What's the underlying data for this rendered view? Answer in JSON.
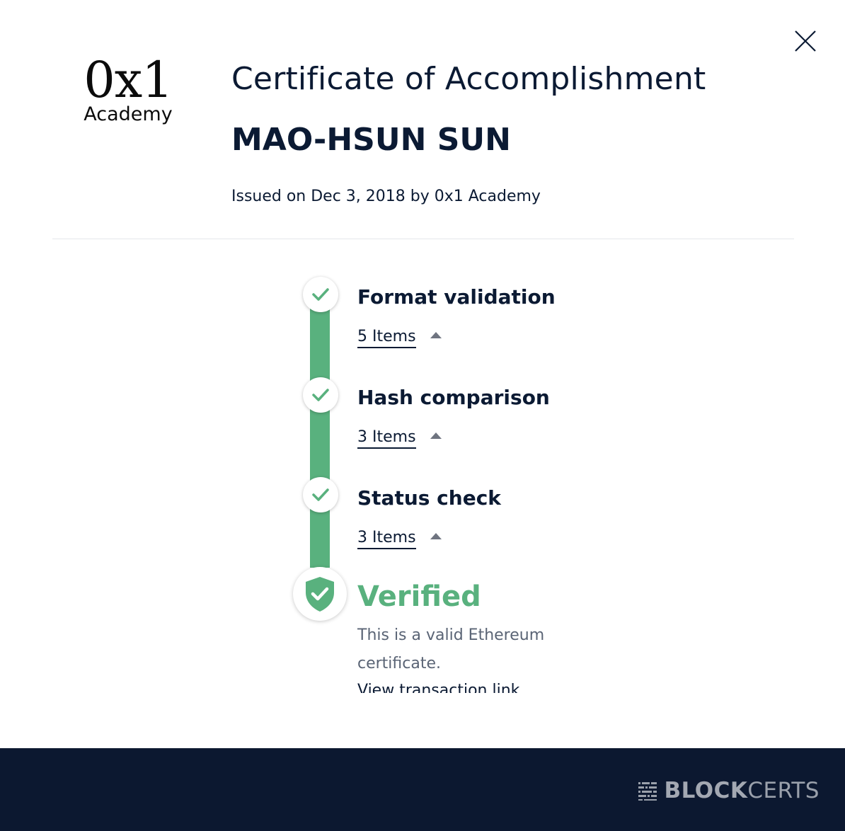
{
  "header": {
    "logo": {
      "mark": "0x1",
      "sub": "Academy"
    },
    "title": "Certificate of Accomplishment",
    "recipient": "MAO-HSUN SUN",
    "issued": "Issued on Dec 3, 2018 by 0x1 Academy"
  },
  "steps": [
    {
      "title": "Format validation",
      "items": "5 Items",
      "status": "passed"
    },
    {
      "title": "Hash comparison",
      "items": "3 Items",
      "status": "passed"
    },
    {
      "title": "Status check",
      "items": "3 Items",
      "status": "passed"
    }
  ],
  "result": {
    "title": "Verified",
    "description": "This is a valid Ethereum certificate.",
    "link": "View transaction link"
  },
  "footer": {
    "brand_bold": "BLOCK",
    "brand_light": "CERTS"
  },
  "colors": {
    "accent": "#59b17e",
    "text": "#0b1a33",
    "footer": "#0c1830"
  },
  "icons": [
    "close-icon",
    "check-icon",
    "shield-check-icon",
    "blockcerts-logo-icon",
    "caret-up-icon"
  ]
}
